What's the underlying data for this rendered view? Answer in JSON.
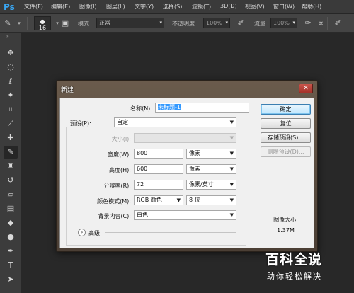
{
  "app": {
    "logo": "Ps"
  },
  "menu": [
    "文件(F)",
    "编辑(E)",
    "图像(I)",
    "图层(L)",
    "文字(Y)",
    "选择(S)",
    "滤镜(T)",
    "3D(D)",
    "视图(V)",
    "窗口(W)",
    "帮助(H)"
  ],
  "options": {
    "brush_size": "16",
    "mode_label": "模式:",
    "mode_value": "正常",
    "opacity_label": "不透明度:",
    "opacity_value": "100%",
    "flow_label": "流量:",
    "flow_value": "100%"
  },
  "tools": [
    "move-tool",
    "marquee-tool",
    "lasso-tool",
    "quick-select-tool",
    "crop-tool",
    "eyedropper-tool",
    "healing-brush-tool",
    "brush-tool",
    "clone-stamp-tool",
    "history-brush-tool",
    "eraser-tool",
    "gradient-tool",
    "blur-tool",
    "dodge-tool",
    "pen-tool",
    "type-tool",
    "path-select-tool",
    "shape-tool"
  ],
  "dialog": {
    "title": "新建",
    "name_label": "名称(N):",
    "name_value": "未标题-1",
    "preset_label": "预设(P):",
    "preset_value": "自定",
    "size_label": "大小(I):",
    "size_value": "",
    "width_label": "宽度(W):",
    "width_value": "800",
    "width_unit": "像素",
    "height_label": "高度(H):",
    "height_value": "600",
    "height_unit": "像素",
    "resolution_label": "分辨率(R):",
    "resolution_value": "72",
    "resolution_unit": "像素/英寸",
    "color_mode_label": "颜色模式(M):",
    "color_mode_value": "RGB 颜色",
    "bit_depth_value": "8 位",
    "background_label": "背景内容(C):",
    "background_value": "白色",
    "advanced_label": "高级",
    "buttons": {
      "ok": "确定",
      "reset": "复位",
      "save_preset": "存储预设(S)...",
      "delete_preset": "删除预设(D)..."
    },
    "image_size_label": "图像大小:",
    "image_size_value": "1.37M"
  },
  "watermark": {
    "title": "百科全说",
    "subtitle": "助你轻松解决"
  },
  "colors": {
    "accent": "#3399ff",
    "ps_blue": "#39a6f2",
    "panel": "#282828"
  }
}
